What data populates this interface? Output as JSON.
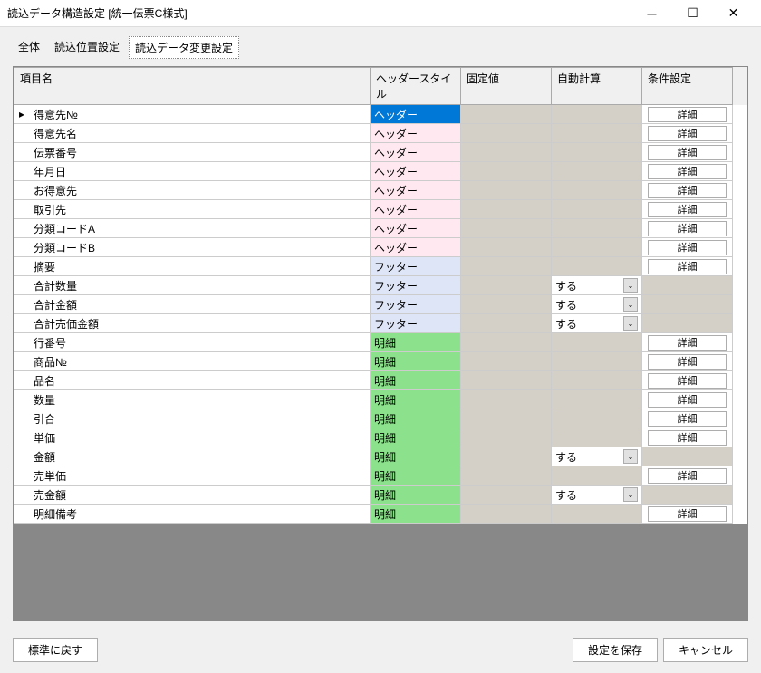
{
  "window": {
    "title": "読込データ構造設定 [統一伝票C様式]"
  },
  "tabs": {
    "all": "全体",
    "position": "読込位置設定",
    "change": "読込データ変更設定"
  },
  "headers": {
    "name": "項目名",
    "style": "ヘッダースタイル",
    "fixed": "固定値",
    "auto": "自動計算",
    "cond": "条件設定"
  },
  "style_labels": {
    "header": "ヘッダー",
    "footer": "フッター",
    "meisai": "明細"
  },
  "auto_option": "する",
  "detail_btn": "詳細",
  "rows": [
    {
      "name": "得意先№",
      "style": "header",
      "selected": true,
      "auto": "",
      "detail": true
    },
    {
      "name": "得意先名",
      "style": "header",
      "auto": "",
      "detail": true
    },
    {
      "name": "伝票番号",
      "style": "header",
      "auto": "",
      "detail": true
    },
    {
      "name": "年月日",
      "style": "header",
      "auto": "",
      "detail": true
    },
    {
      "name": "お得意先",
      "style": "header",
      "auto": "",
      "detail": true
    },
    {
      "name": "取引先",
      "style": "header",
      "auto": "",
      "detail": true
    },
    {
      "name": "分類コードA",
      "style": "header",
      "auto": "",
      "detail": true
    },
    {
      "name": "分類コードB",
      "style": "header",
      "auto": "",
      "detail": true
    },
    {
      "name": "摘要",
      "style": "footer",
      "auto": "",
      "detail": true
    },
    {
      "name": "合計数量",
      "style": "footer",
      "auto": "select",
      "detail": false
    },
    {
      "name": "合計金額",
      "style": "footer",
      "auto": "select",
      "detail": false
    },
    {
      "name": "合計売価金額",
      "style": "footer",
      "auto": "select",
      "detail": false
    },
    {
      "name": "行番号",
      "style": "meisai",
      "auto": "",
      "detail": true
    },
    {
      "name": "商品№",
      "style": "meisai",
      "auto": "",
      "detail": true
    },
    {
      "name": "品名",
      "style": "meisai",
      "auto": "",
      "detail": true
    },
    {
      "name": "数量",
      "style": "meisai",
      "auto": "",
      "detail": true
    },
    {
      "name": "引合",
      "style": "meisai",
      "auto": "",
      "detail": true
    },
    {
      "name": "単価",
      "style": "meisai",
      "auto": "",
      "detail": true
    },
    {
      "name": "金額",
      "style": "meisai",
      "auto": "select",
      "detail": false
    },
    {
      "name": "売単価",
      "style": "meisai",
      "auto": "",
      "detail": true
    },
    {
      "name": "売金額",
      "style": "meisai",
      "auto": "select",
      "detail": false
    },
    {
      "name": "明細備考",
      "style": "meisai",
      "auto": "",
      "detail": true
    }
  ],
  "footer": {
    "reset": "標準に戻す",
    "save": "設定を保存",
    "cancel": "キャンセル"
  }
}
